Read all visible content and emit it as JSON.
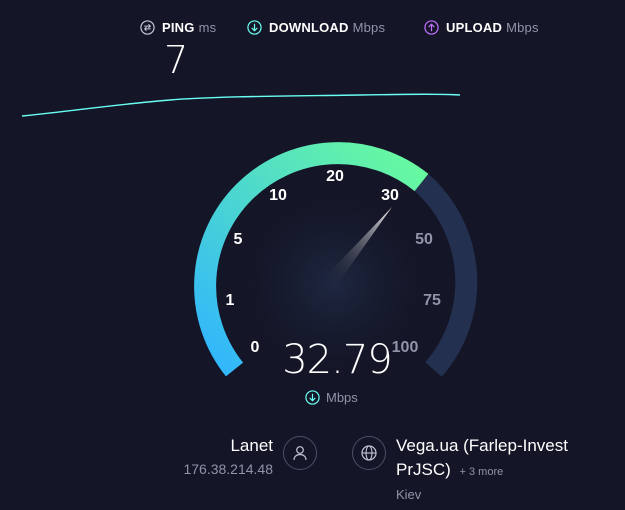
{
  "metrics": {
    "ping": {
      "label": "PING",
      "unit": "ms",
      "value": "7",
      "icon": "ping-arrows-icon",
      "color": "#c4c5d4"
    },
    "download": {
      "label": "DOWNLOAD",
      "unit": "Mbps",
      "icon": "download-arrow-icon",
      "color": "#6afff3"
    },
    "upload": {
      "label": "UPLOAD",
      "unit": "Mbps",
      "icon": "upload-arrow-icon",
      "color": "#bf71ff"
    }
  },
  "gauge": {
    "ticks": [
      "0",
      "1",
      "5",
      "10",
      "20",
      "30",
      "50",
      "75",
      "100"
    ],
    "current_value": "32.79",
    "unit": "Mbps",
    "colors": {
      "start": "#30b4ff",
      "end": "#6afc9c",
      "track": "#23304f"
    }
  },
  "isp": {
    "name": "Lanet",
    "ip": "176.38.214.48",
    "icon": "user-icon"
  },
  "server": {
    "name_line1": "Vega.ua (Farlep-Invest",
    "name_line2": "PrJSC)",
    "more": "+ 3 more",
    "location": "Kiev",
    "icon": "globe-icon"
  }
}
